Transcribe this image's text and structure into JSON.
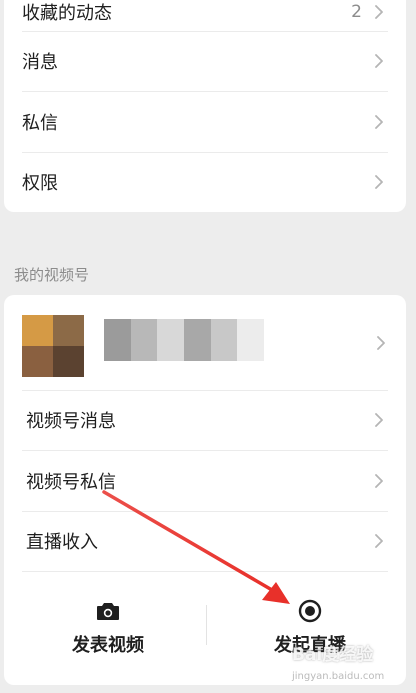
{
  "top_card": {
    "items": [
      {
        "label": "收藏的动态",
        "count": "2"
      },
      {
        "label": "消息"
      },
      {
        "label": "私信"
      },
      {
        "label": "权限"
      }
    ]
  },
  "channels_section": {
    "title": "我的视频号",
    "items": [
      {
        "label": "视频号消息"
      },
      {
        "label": "视频号私信"
      },
      {
        "label": "直播收入"
      }
    ]
  },
  "actions": {
    "post_video": "发表视频",
    "start_live": "发起直播"
  },
  "watermark": {
    "text": "Bai度经验",
    "url": "jingyan.baidu.com"
  },
  "icons": {
    "chevron": "chevron-right-icon",
    "camera": "camera-icon",
    "live": "live-record-icon"
  },
  "colors": {
    "background": "#ededed",
    "card": "#ffffff",
    "arrow": "#e8302a",
    "secondary_text": "#8c8c8c"
  }
}
